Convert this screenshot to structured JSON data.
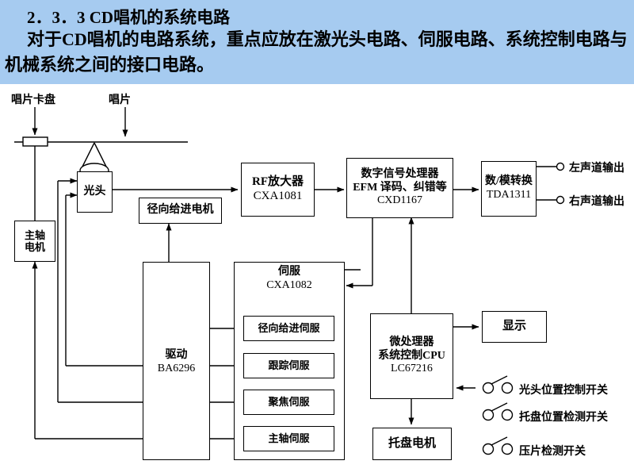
{
  "header": {
    "section_number": "2．3．3",
    "title": "CD唱机的系统电路",
    "paragraph": "对于CD唱机的电路系统，重点应放在激光头电路、伺服电路、系统控制电路与机械系统之间的接口电路。",
    "background_color": "#a6cbf0"
  },
  "diagram": {
    "callouts": [
      {
        "id": "disc-clamp",
        "label": "唱片卡盘"
      },
      {
        "id": "disc",
        "label": "唱片"
      }
    ],
    "blocks": {
      "pickup": {
        "label": "光头"
      },
      "spindle_motor": {
        "line1": "主轴",
        "line2": "电机"
      },
      "radial_feed_motor": {
        "label": "径向给进电机"
      },
      "rf_amp": {
        "line1": "RF放大器",
        "line2": "CXA1081"
      },
      "dsp": {
        "line1": "数字信号处理器",
        "line2": "EFM 译码、纠错等",
        "line3": "CXD1167"
      },
      "dac": {
        "line1": "数/模转换",
        "line2": "TDA1311"
      },
      "driver": {
        "line1": "驱动",
        "line2": "BA6296"
      },
      "servo": {
        "line1": "伺服",
        "line2": "CXA1082"
      },
      "cpu": {
        "line1": "微处理器",
        "line2": "系统控制CPU",
        "line3": "LC67216"
      },
      "display": {
        "label": "显示"
      },
      "tray_motor": {
        "label": "托盘电机"
      }
    },
    "servo_channels": [
      {
        "id": "radial-feed-servo",
        "label": "径向给进伺服"
      },
      {
        "id": "tracking-servo",
        "label": "跟踪伺服"
      },
      {
        "id": "focus-servo",
        "label": "聚焦伺服"
      },
      {
        "id": "spindle-servo",
        "label": "主轴伺服"
      }
    ],
    "outputs": [
      {
        "id": "left-channel-output",
        "label": "左声道输出"
      },
      {
        "id": "right-channel-output",
        "label": "右声道输出"
      }
    ],
    "switches": [
      {
        "id": "pickup-position-control-switch",
        "label": "光头位置控制开关"
      },
      {
        "id": "tray-position-detect-switch",
        "label": "托盘位置检测开关"
      },
      {
        "id": "disc-press-detect-switch",
        "label": "压片检测开关"
      }
    ]
  }
}
